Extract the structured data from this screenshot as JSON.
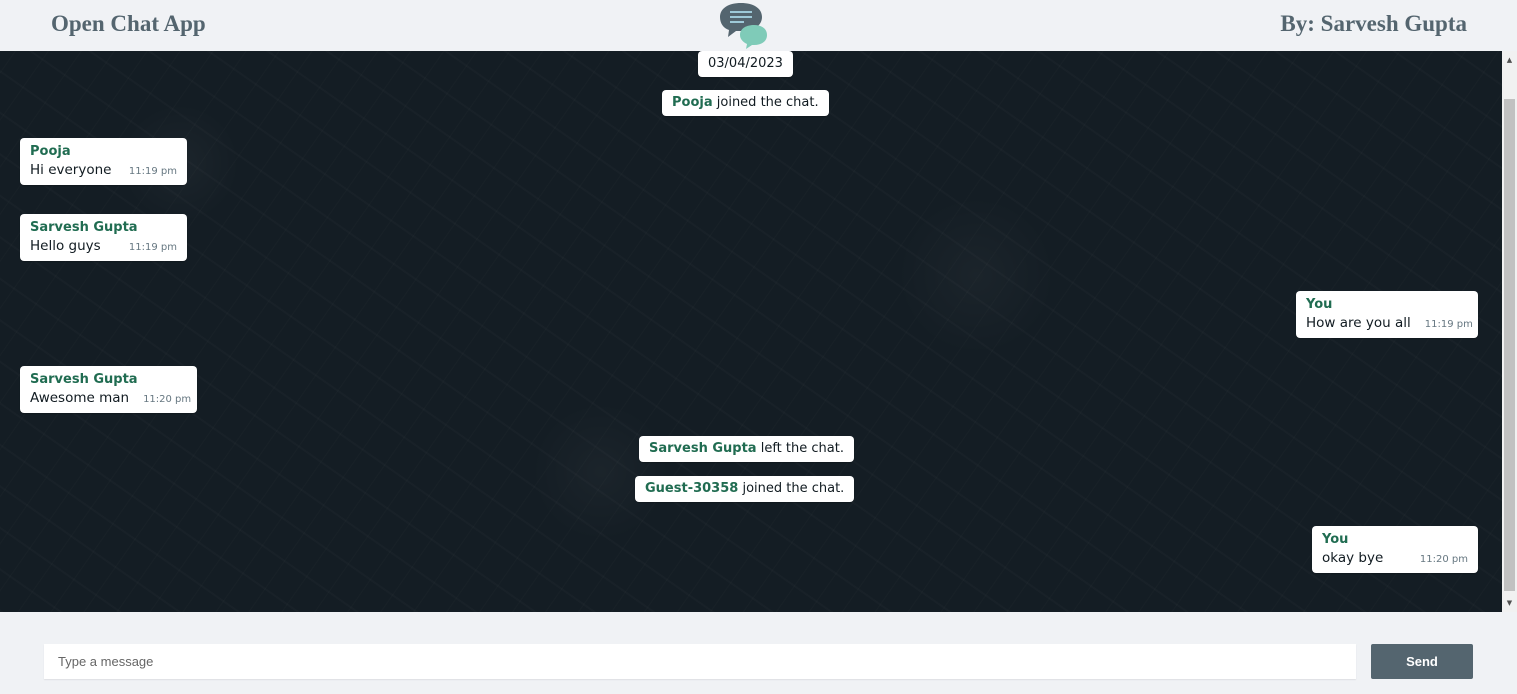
{
  "header": {
    "app_title": "Open Chat App",
    "author": "By: Sarvesh Gupta",
    "logo_icon": "chat-bubbles-icon"
  },
  "chat": {
    "date": "03/04/2023",
    "events": [
      {
        "who": "Pooja",
        "action": "joined the chat."
      },
      {
        "who": "Sarvesh Gupta",
        "action": "left the chat."
      },
      {
        "who": "Guest-30358",
        "action": "joined the chat."
      }
    ],
    "messages": [
      {
        "sender": "Pooja",
        "text": "Hi everyone",
        "time": "11:19 pm",
        "side": "left"
      },
      {
        "sender": "Sarvesh Gupta",
        "text": "Hello guys",
        "time": "11:19 pm",
        "side": "left"
      },
      {
        "sender": "You",
        "text": "How are you all",
        "time": "11:19 pm",
        "side": "right"
      },
      {
        "sender": "Sarvesh Gupta",
        "text": "Awesome man",
        "time": "11:20 pm",
        "side": "left"
      },
      {
        "sender": "You",
        "text": "okay bye",
        "time": "11:20 pm",
        "side": "right"
      }
    ]
  },
  "composer": {
    "placeholder": "Type a message",
    "value": "",
    "send_label": "Send"
  },
  "colors": {
    "header_bg": "#f0f2f5",
    "header_text": "#54656f",
    "chat_bg": "#141d24",
    "sender_name": "#206c51",
    "send_button": "#54656f",
    "logo_dark": "#54656f",
    "logo_light": "#7fcbb8"
  }
}
